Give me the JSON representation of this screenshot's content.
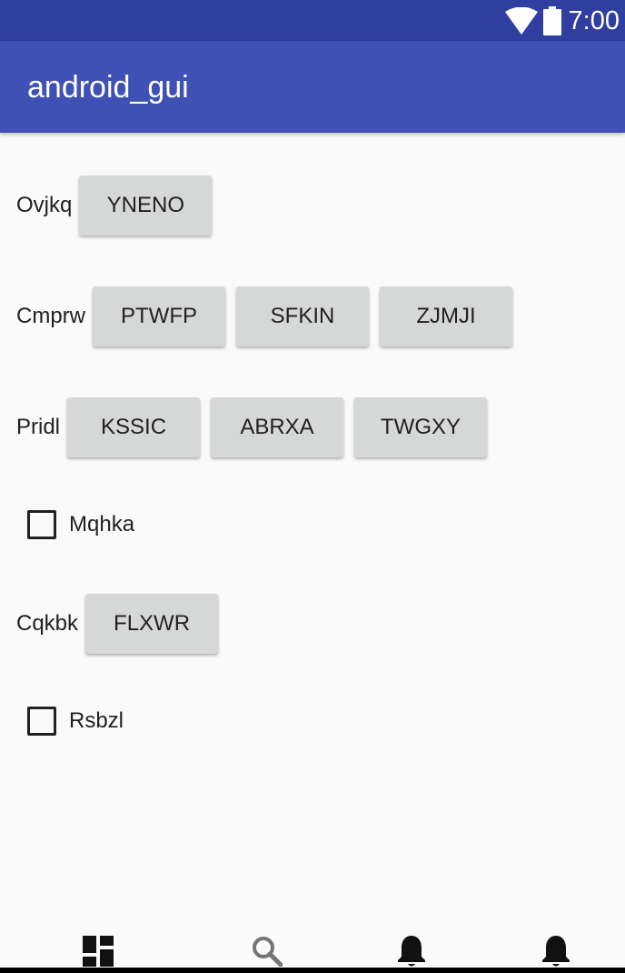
{
  "status_bar": {
    "time": "7:00",
    "colors": {
      "background": "#303f9f"
    },
    "icons": [
      "wifi-icon",
      "battery-icon"
    ]
  },
  "app_bar": {
    "title": "android_gui",
    "colors": {
      "background": "#3f51b5"
    }
  },
  "rows": [
    {
      "label": "Ovjkq",
      "buttons": [
        "YNENO"
      ]
    },
    {
      "label": "Cmprw",
      "buttons": [
        "PTWFP",
        "SFKIN",
        "ZJMJI"
      ]
    },
    {
      "label": "Pridl",
      "buttons": [
        "KSSIC",
        "ABRXA",
        "TWGXY"
      ]
    },
    {
      "label": "Cqkbk",
      "buttons": [
        "FLXWR"
      ]
    }
  ],
  "checkboxes": [
    {
      "label": "Mqhka",
      "checked": false
    },
    {
      "label": "Rsbzl",
      "checked": false
    }
  ],
  "bottom_nav": {
    "items": [
      "dashboard-icon",
      "search-icon",
      "notifications-icon",
      "notifications-icon"
    ]
  }
}
